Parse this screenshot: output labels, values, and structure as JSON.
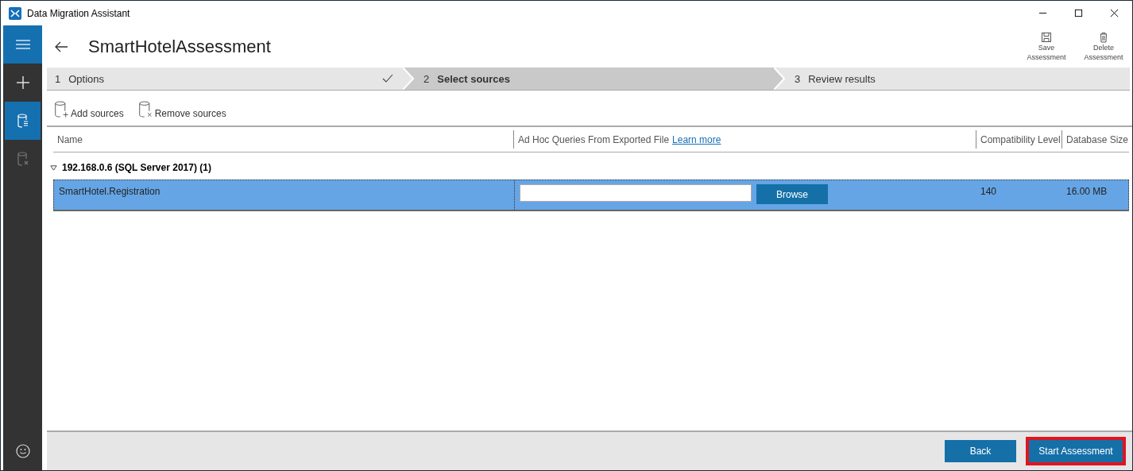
{
  "window": {
    "title": "Data Migration Assistant"
  },
  "sidebar": {
    "items": [
      {
        "kind": "menu",
        "selected": false,
        "disabled": false
      },
      {
        "kind": "add",
        "selected": false,
        "disabled": false
      },
      {
        "kind": "assessment",
        "selected": true,
        "disabled": false
      },
      {
        "kind": "migration",
        "selected": false,
        "disabled": true
      }
    ]
  },
  "page": {
    "title": "SmartHotelAssessment"
  },
  "actions": [
    {
      "kind": "save",
      "label": "Save\nAssessment"
    },
    {
      "kind": "delete",
      "label": "Delete\nAssessment"
    }
  ],
  "steps": [
    {
      "number": "1",
      "label": "Options",
      "selected": false,
      "completed": true
    },
    {
      "number": "2",
      "label": "Select sources",
      "selected": true,
      "completed": false
    },
    {
      "number": "3",
      "label": "Review results",
      "selected": false,
      "completed": false
    }
  ],
  "toolbar": [
    {
      "kind": "add",
      "label": "Add sources"
    },
    {
      "kind": "remove",
      "label": "Remove sources"
    }
  ],
  "table": {
    "columns": [
      {
        "label": "Name"
      },
      {
        "label": "Ad Hoc Queries From Exported File",
        "link": "Learn more"
      },
      {
        "label": "Compatibility Level"
      },
      {
        "label": "Database Size"
      }
    ],
    "groups": [
      {
        "label": "192.168.0.6 (SQL Server 2017) (1)",
        "expanded": true,
        "rows": [
          {
            "name": "SmartHotel.Registration",
            "button": "Browse",
            "compatibility": "140",
            "size": "16.00 MB",
            "selected": true
          }
        ]
      }
    ]
  },
  "footer": {
    "buttons": [
      {
        "label": "Back",
        "highlighted": false
      },
      {
        "label": "Start Assessment",
        "highlighted": true
      }
    ]
  }
}
